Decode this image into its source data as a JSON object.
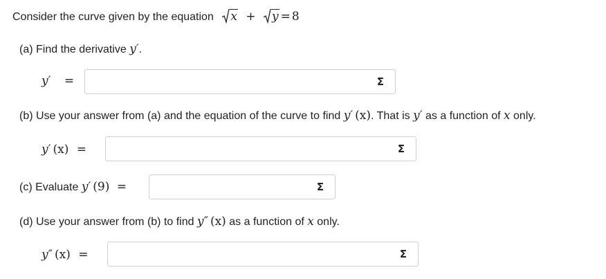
{
  "intro": {
    "text": "Consider the curve given by the equation",
    "equation": {
      "x": "x",
      "plus": "+",
      "y": "y",
      "equals": "=",
      "rhs": "8"
    }
  },
  "parts": [
    {
      "id": "a",
      "prompt": {
        "label": "(a) Find the derivative",
        "expr": "y′",
        "end": "."
      },
      "answer": {
        "lhs_var": "y",
        "lhs_prime": "′",
        "lhs_arg": "",
        "equals": "=",
        "value": "",
        "placeholder": ""
      },
      "sigma": "Σ"
    },
    {
      "id": "b",
      "prompt": {
        "label": "(b) Use your answer from (a) and the equation of the curve to find",
        "expr": "y′",
        "arg": "(x)",
        "mid": ". That is",
        "expr2": "y′",
        "mid2": "as a function of",
        "var": "x",
        "end": "only."
      },
      "answer": {
        "lhs_var": "y",
        "lhs_prime": "′",
        "lhs_arg": "(x)",
        "equals": "=",
        "value": "",
        "placeholder": ""
      },
      "sigma": "Σ"
    },
    {
      "id": "c",
      "prompt": {
        "label": "(c) Evaluate",
        "expr": "y′",
        "arg": "(9)"
      },
      "answer": {
        "equals": "=",
        "value": "",
        "placeholder": ""
      },
      "sigma": "Σ"
    },
    {
      "id": "d",
      "prompt": {
        "label": "(d) Use your answer from (b) to find",
        "expr": "y″",
        "arg": "(x)",
        "mid": "as a function of",
        "var": "x",
        "end": "only."
      },
      "answer": {
        "lhs_var": "y",
        "lhs_prime": "″",
        "lhs_arg": "(x)",
        "equals": "=",
        "value": "",
        "placeholder": ""
      },
      "sigma": "Σ"
    }
  ],
  "icons": {
    "sigma_button": "sigma-icon"
  }
}
